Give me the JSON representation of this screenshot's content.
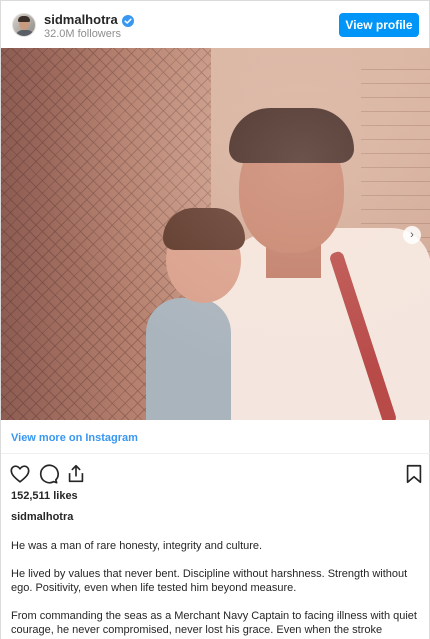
{
  "header": {
    "username": "sidmalhotra",
    "followers": "32.0M followers",
    "view_profile_label": "View profile"
  },
  "post": {
    "view_more_label": "View more on Instagram",
    "likes": "152,511 likes",
    "owner": "sidmalhotra",
    "caption": [
      "He was a man of rare honesty, integrity and culture.",
      "He lived by values that never bent. Discipline without harshness. Strength without ego. Positivity, even when life tested him beyond measure.",
      "From commanding the seas as a Merchant Navy Captain to facing illness with quiet courage, he never compromised, never lost his grace. Even when the stroke"
    ]
  },
  "icons": {
    "like": "heart-icon",
    "comment": "comment-icon",
    "share": "share-icon",
    "save": "bookmark-icon",
    "verified": "verified-badge-icon",
    "carousel": "chevron-right-icon"
  },
  "colors": {
    "accent": "#0095f6",
    "link": "#3897f0",
    "text": "#262626",
    "muted": "#8e8e8e"
  }
}
